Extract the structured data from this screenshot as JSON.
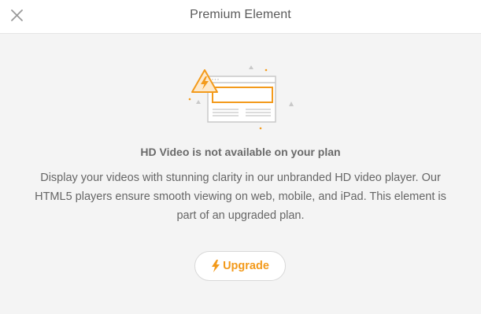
{
  "header": {
    "title": "Premium Element",
    "close_icon": "close-icon"
  },
  "content": {
    "heading": "HD Video is not available on your plan",
    "description": "Display your videos with stunning clarity in our unbranded HD video player. Our HTML5 players ensure smooth viewing on web, mobile, and iPad. This element is part of an upgraded plan.",
    "illustration_icon": "warning-browser-illustration"
  },
  "upgrade_button": {
    "label": "Upgrade",
    "icon": "lightning-icon"
  },
  "colors": {
    "accent": "#f39a1b",
    "text": "#666666",
    "background": "#f4f4f4"
  }
}
